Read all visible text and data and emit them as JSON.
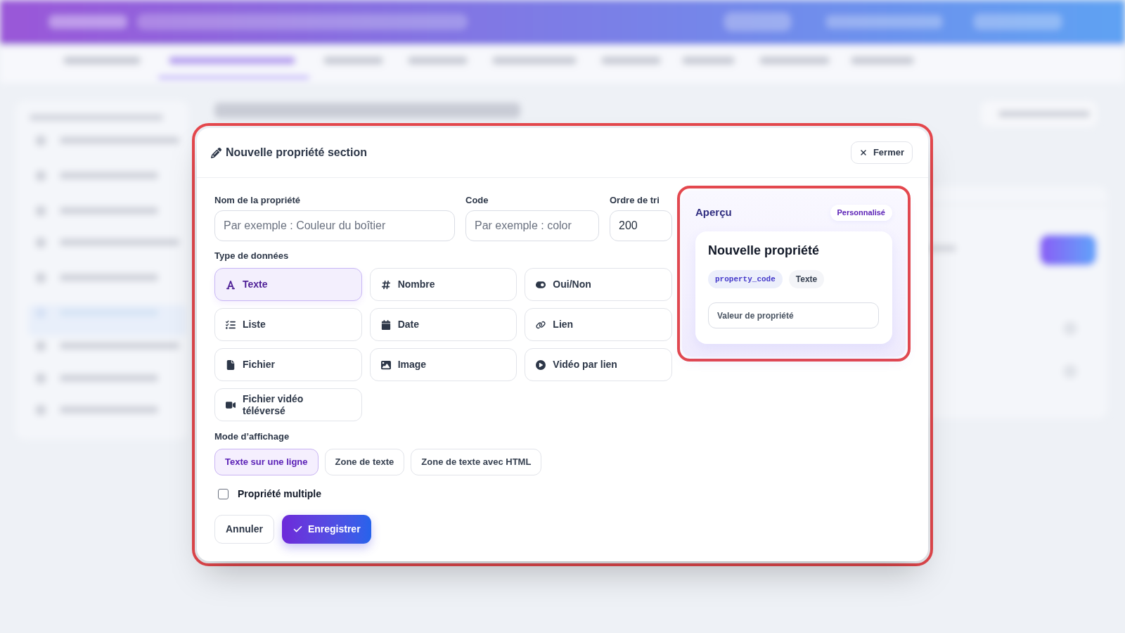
{
  "dialog": {
    "highlighted": true,
    "title": "Nouvelle propriété section",
    "close_button": "Fermer",
    "fields": [
      {
        "label": "Nom de la propriété",
        "placeholder": "Par exemple : Couleur du boîtier"
      },
      {
        "label": "Code",
        "placeholder": "Par exemple : color"
      },
      {
        "label": "Ordre de tri",
        "value": "200"
      }
    ],
    "data_type": {
      "label": "Type de données",
      "options": [
        {
          "label": "Texte",
          "selected": true
        },
        {
          "label": "Nombre",
          "selected": false
        },
        {
          "label": "Oui/Non",
          "selected": false
        },
        {
          "label": "Liste",
          "selected": false
        },
        {
          "label": "Date",
          "selected": false
        },
        {
          "label": "Lien",
          "selected": false
        },
        {
          "label": "Fichier",
          "selected": false
        },
        {
          "label": "Image",
          "selected": false
        },
        {
          "label": "Vidéo par lien",
          "selected": false
        },
        {
          "label": "Fichier vidéo téléversé",
          "selected": false
        }
      ]
    },
    "display_mode": {
      "label": "Mode d’affichage",
      "options": [
        {
          "label": "Texte sur une ligne",
          "selected": true
        },
        {
          "label": "Zone de texte",
          "selected": false
        },
        {
          "label": "Zone de texte avec HTML",
          "selected": false
        }
      ]
    },
    "multiple": {
      "label": "Propriété multiple",
      "checked": false
    },
    "actions": {
      "cancel": "Annuler",
      "save": "Enregistrer"
    },
    "preview": {
      "highlighted": true,
      "title": "Aperçu",
      "badge": "Personnalisé",
      "name": "Nouvelle propriété",
      "tags": [
        {
          "kind": "code",
          "text": "property_code"
        },
        {
          "kind": "type",
          "text": "Texte"
        }
      ],
      "value_field": {
        "placeholder": "Valeur de propriété"
      }
    }
  }
}
